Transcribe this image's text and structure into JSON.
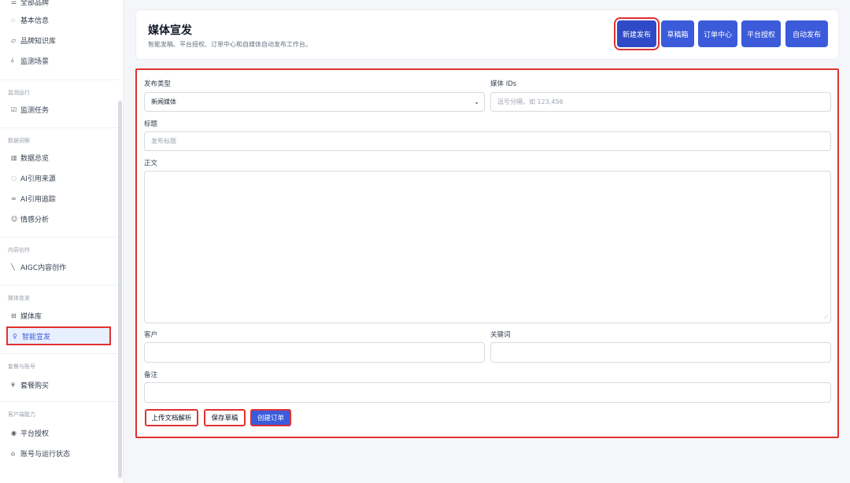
{
  "sidebar": {
    "top_item": "全部品牌",
    "items_brand": [
      "基本信息",
      "品牌知识库",
      "监测场景"
    ],
    "section_monitor": "监测运行",
    "monitor_task": "监测任务",
    "section_insight": "数据洞察",
    "insight_items": [
      "数据总览",
      "AI引用来源",
      "AI引用追踪",
      "情感分析"
    ],
    "section_content": "内容创作",
    "content_item": "AIGC内容创作",
    "section_media": "媒体宣发",
    "media_library": "媒体库",
    "media_smart": "智能宣发",
    "section_plan": "套餐与账号",
    "plan_buy": "套餐购买",
    "section_client": "客户端能力",
    "client_items": [
      "平台授权",
      "账号与运行状态"
    ]
  },
  "header": {
    "title": "媒体宣发",
    "subtitle": "智能发稿、平台授权、订单中心和自媒体自动发布工作台。",
    "buttons": [
      "新建发布",
      "草稿箱",
      "订单中心",
      "平台授权",
      "自动发布"
    ]
  },
  "form": {
    "type_label": "发布类型",
    "type_value": "新闻媒体",
    "media_ids_label": "媒体 IDs",
    "media_ids_placeholder": "逗号分隔，如 123,456",
    "title_label": "标题",
    "title_placeholder": "发布标题",
    "body_label": "正文",
    "customer_label": "客户",
    "keywords_label": "关键词",
    "remark_label": "备注",
    "btn_upload": "上传文档解析",
    "btn_save": "保存草稿",
    "btn_create": "创建订单"
  },
  "colors": {
    "primary": "#3b5bdb",
    "highlight": "#e03131"
  }
}
